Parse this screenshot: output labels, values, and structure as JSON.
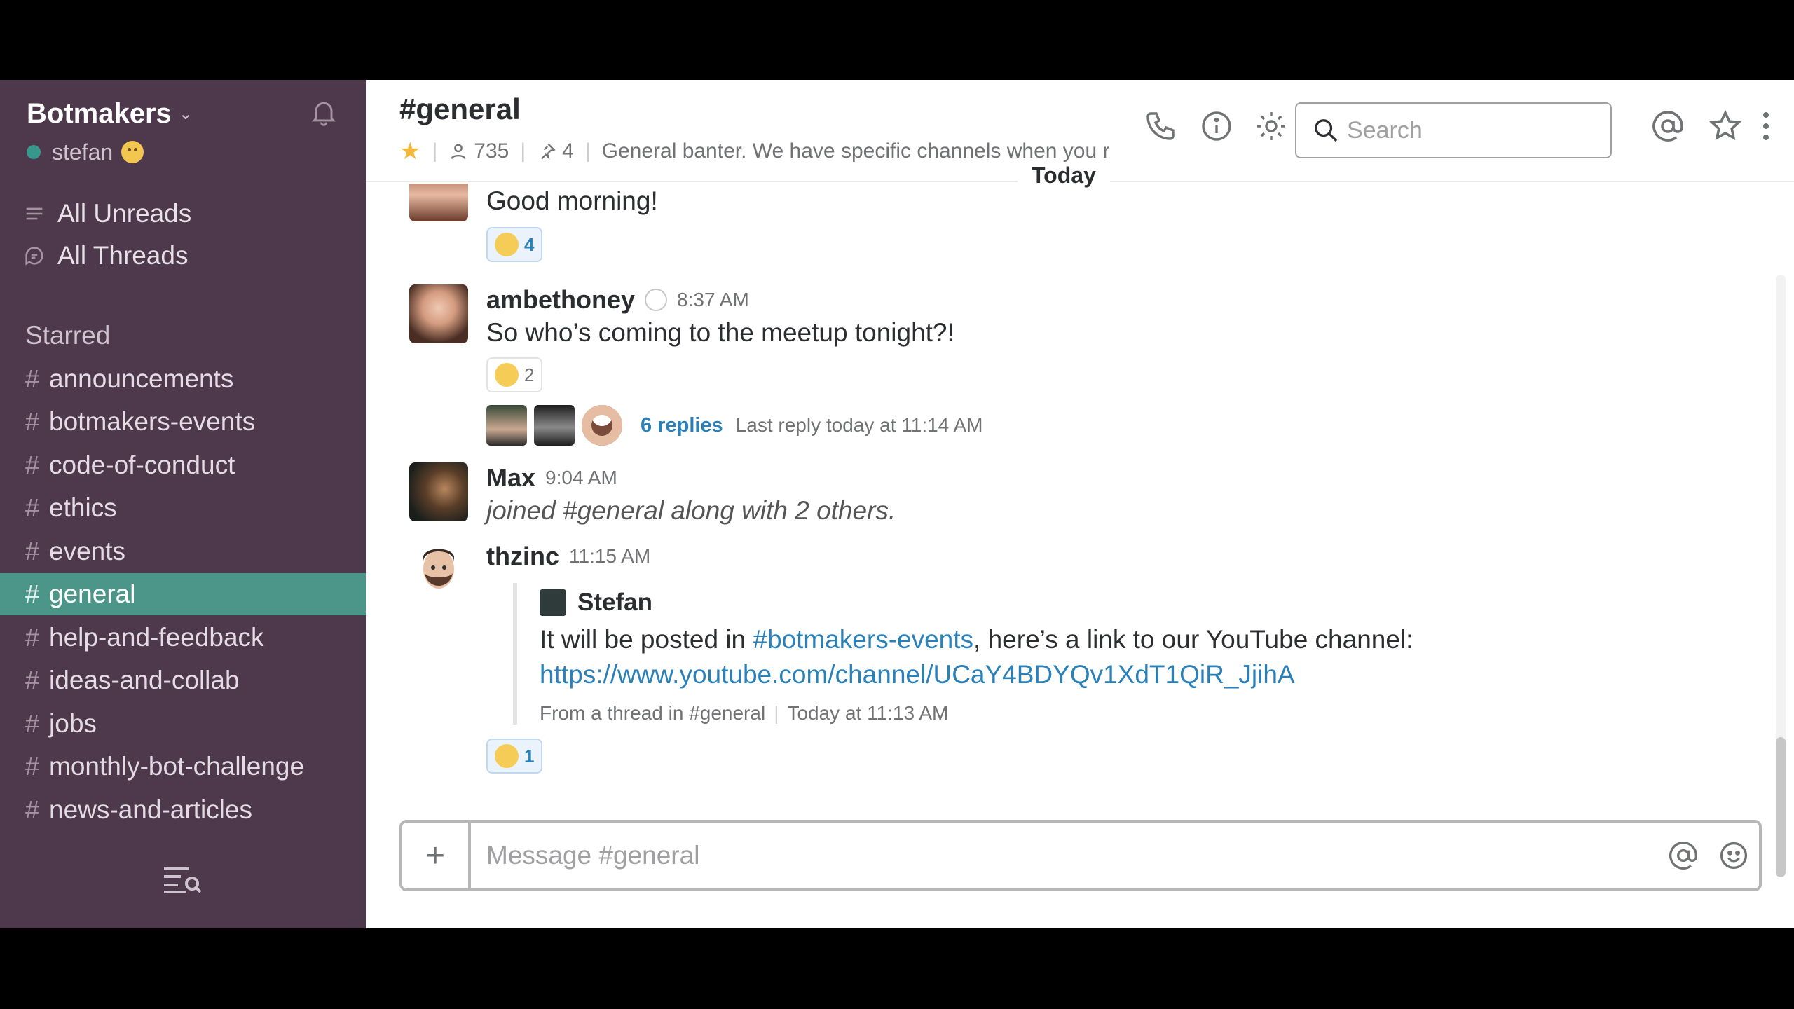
{
  "sidebar": {
    "team_name": "Botmakers",
    "username": "stefan",
    "nav": [
      {
        "label": "All Unreads",
        "icon": "unreads-icon"
      },
      {
        "label": "All Threads",
        "icon": "threads-icon"
      }
    ],
    "section_label": "Starred",
    "channels": [
      {
        "name": "announcements",
        "active": false
      },
      {
        "name": "botmakers-events",
        "active": false
      },
      {
        "name": "code-of-conduct",
        "active": false
      },
      {
        "name": "ethics",
        "active": false
      },
      {
        "name": "events",
        "active": false
      },
      {
        "name": "general",
        "active": true
      },
      {
        "name": "help-and-feedback",
        "active": false
      },
      {
        "name": "ideas-and-collab",
        "active": false
      },
      {
        "name": "jobs",
        "active": false
      },
      {
        "name": "monthly-bot-challenge",
        "active": false
      },
      {
        "name": "news-and-articles",
        "active": false
      }
    ],
    "hash_symbol": "#"
  },
  "header": {
    "channel_title": "#general",
    "member_count": "735",
    "pinned_count": "4",
    "topic": "General banter. We have specific channels when you r",
    "search_placeholder": "Search"
  },
  "divider": {
    "label": "Today"
  },
  "messages": [
    {
      "text": "Good morning!",
      "reaction_count": "4"
    },
    {
      "author": "ambethoney",
      "time": "8:37 AM",
      "text": "So who’s coming to the meetup tonight?!",
      "reaction_count": "2",
      "thread": {
        "replies": "6 replies",
        "last_reply": "Last reply today at 11:14 AM"
      }
    },
    {
      "author": "Max",
      "time": "9:04 AM",
      "text": "joined #general along with 2 others."
    },
    {
      "author": "thzinc",
      "time": "11:15 AM",
      "quote": {
        "author": "Stefan",
        "text_before": "It will be posted in ",
        "channel_link": "#botmakers-events",
        "text_after": ", here’s a link to our YouTube channel:",
        "url": "https://www.youtube.com/channel/UCaY4BDYQv1XdT1QiR_JjihA",
        "source": "From a thread in #general",
        "timestamp": "Today at 11:13 AM"
      },
      "reaction_count": "1"
    }
  ],
  "composer": {
    "placeholder": "Message #general",
    "plus": "+"
  },
  "colors": {
    "sidebar_bg": "#4d394b",
    "active_channel": "#4c9689",
    "link": "#2a80b9",
    "presence": "#38978d",
    "star": "#f5b73b"
  }
}
